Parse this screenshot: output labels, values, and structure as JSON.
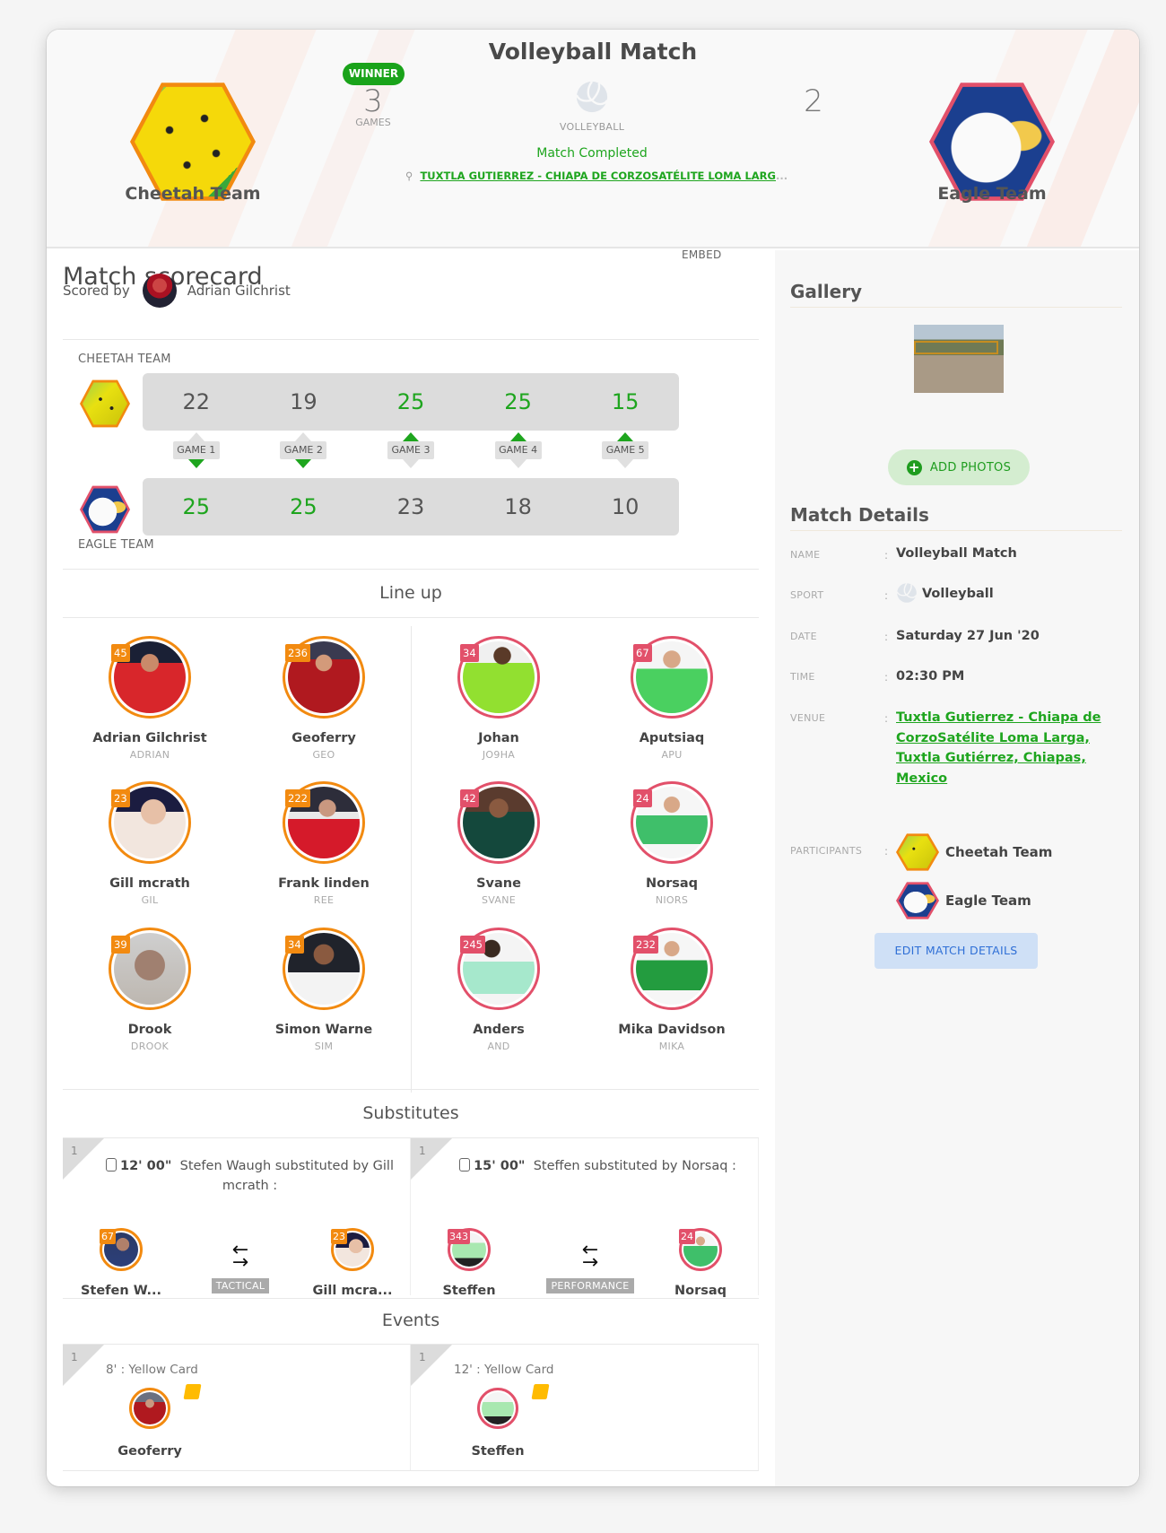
{
  "header": {
    "title": "Volleyball Match",
    "home_team": {
      "name": "Cheetah Team",
      "score": "3",
      "winner_label": "WINNER",
      "score_unit": "GAMES",
      "color": "#f28a10"
    },
    "away_team": {
      "name": "Eagle Team",
      "score": "2",
      "color": "#e2506a"
    },
    "sport_label": "VOLLEYBALL",
    "status": "Match Completed",
    "location": "TUXTLA GUTIERREZ - CHIAPA DE CORZOSATÉLITE LOMA LARG",
    "location_ellipsis": "...",
    "pin_icon": "map-pin-icon",
    "sport_icon": "volleyball-icon"
  },
  "scorecard": {
    "title": "Match scorecard",
    "scored_by_label": "Scored by",
    "scorer": "Adrian Gilchrist",
    "embed_label": "EMBED",
    "home_label": "CHEETAH TEAM",
    "away_label": "EAGLE TEAM",
    "games": [
      {
        "label": "GAME 1",
        "home": "22",
        "away": "25",
        "winner": "away"
      },
      {
        "label": "GAME 2",
        "home": "19",
        "away": "25",
        "winner": "away"
      },
      {
        "label": "GAME 3",
        "home": "25",
        "away": "23",
        "winner": "home"
      },
      {
        "label": "GAME 4",
        "home": "25",
        "away": "18",
        "winner": "home"
      },
      {
        "label": "GAME 5",
        "home": "15",
        "away": "10",
        "winner": "home"
      }
    ]
  },
  "lineup": {
    "title": "Line up",
    "home": [
      {
        "name": "Adrian Gilchrist",
        "handle": "ADRIAN",
        "jersey": "45"
      },
      {
        "name": "Geoferry",
        "handle": "GEO",
        "jersey": "236"
      },
      {
        "name": "Gill mcrath",
        "handle": "GIL",
        "jersey": "23"
      },
      {
        "name": "Frank linden",
        "handle": "REE",
        "jersey": "222"
      },
      {
        "name": "Drook",
        "handle": "DROOK",
        "jersey": "39"
      },
      {
        "name": "Simon Warne",
        "handle": "SIM",
        "jersey": "34"
      }
    ],
    "away": [
      {
        "name": "Johan",
        "handle": "JO9HA",
        "jersey": "34"
      },
      {
        "name": "Aputsiaq",
        "handle": "APU",
        "jersey": "67"
      },
      {
        "name": "Svane",
        "handle": "SVANE",
        "jersey": "42"
      },
      {
        "name": "Norsaq",
        "handle": "NIORS",
        "jersey": "24"
      },
      {
        "name": "Anders",
        "handle": "AND",
        "jersey": "245"
      },
      {
        "name": "Mika Davidson",
        "handle": "MIKA",
        "jersey": "232"
      }
    ]
  },
  "substitutes": {
    "title": "Substitutes",
    "items": [
      {
        "index": "1",
        "time": "12' 00\"",
        "text": "Stefen Waugh substituted by Gill mcrath :",
        "out_name": "Stefen W...",
        "out_jersey": "67",
        "in_name": "Gill mcra...",
        "in_jersey": "23",
        "reason": "TACTICAL",
        "team": "home"
      },
      {
        "index": "1",
        "time": "15' 00\"",
        "text": "Steffen substituted by Norsaq :",
        "out_name": "Steffen",
        "out_jersey": "343",
        "in_name": "Norsaq",
        "in_jersey": "24",
        "reason": "PERFORMANCE",
        "team": "away"
      }
    ]
  },
  "events": {
    "title": "Events",
    "items": [
      {
        "index": "1",
        "title": "8' : Yellow Card",
        "player": "Geoferry",
        "team": "home"
      },
      {
        "index": "1",
        "title": "12' : Yellow Card",
        "player": "Steffen",
        "team": "away"
      }
    ]
  },
  "gallery": {
    "title": "Gallery",
    "add_photos_label": "ADD PHOTOS"
  },
  "details": {
    "title": "Match Details",
    "name_label": "NAME",
    "name": "Volleyball Match",
    "sport_label": "SPORT",
    "sport": "Volleyball",
    "date_label": "DATE",
    "date": "Saturday 27 Jun '20",
    "time_label": "TIME",
    "time": "02:30 PM",
    "venue_label": "VENUE",
    "venue": "Tuxtla Gutierrez - Chiapa de CorzoSatélite Loma Larga, Tuxtla Gutiérrez, Chiapas, Mexico",
    "participants_label": "PARTICIPANTS",
    "participants": [
      "Cheetah Team",
      "Eagle Team"
    ],
    "colon": ":",
    "edit_label": "EDIT MATCH DETAILS"
  },
  "colors": {
    "accent_green": "#1ea51e",
    "home": "#f28a10",
    "away": "#e2506a",
    "edit_blue": "#2f6fd6"
  }
}
